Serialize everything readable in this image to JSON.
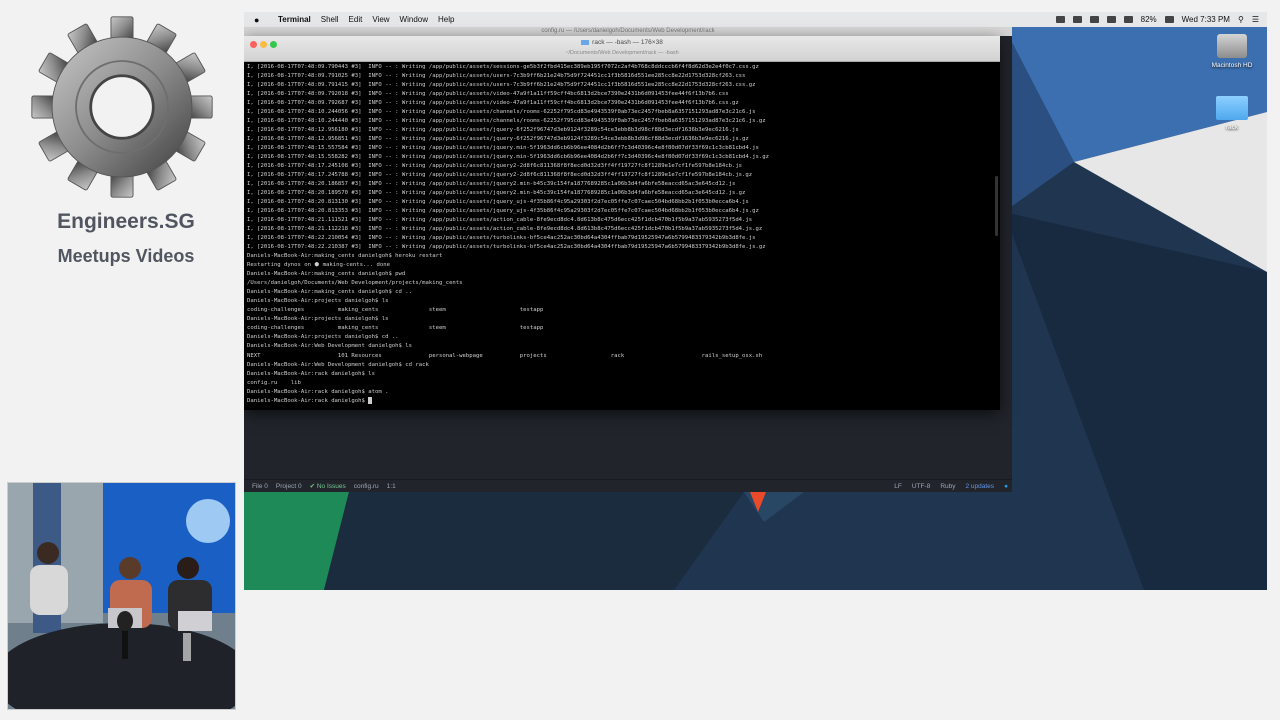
{
  "brand": {
    "title": "Engineers.SG",
    "subtitle": "Meetups Videos"
  },
  "menubar": {
    "app": "Terminal",
    "items": [
      "Shell",
      "Edit",
      "View",
      "Window",
      "Help"
    ],
    "battery": "82%",
    "clock": "Wed 7:33 PM"
  },
  "editor": {
    "title": "config.ru — /Users/danielgoh/Documents/Web Development/rack",
    "status": {
      "file": "File 0",
      "project": "Project 0",
      "issues": "No Issues",
      "filename": "config.ru",
      "cursor": "1:1",
      "line_ending": "LF",
      "encoding": "UTF-8",
      "grammar": "Ruby",
      "updates": "2 updates"
    }
  },
  "terminal": {
    "title": "rack — -bash — 176×38",
    "subtitle": "~/Documents/Web Development/rack — -bash",
    "lines": [
      "I, [2016-08-17T07:48:09.790443 #3]  INFO -- : Writing /app/public/assets/sessions-ge5b3f2fbd415ec389eb195f7072c2af4b768c8ddcccb6f4f8d62d3e2e4f0c7.css.gz",
      "I, [2016-08-17T07:48:09.791025 #3]  INFO -- : Writing /app/public/assets/users-7c3b9ff6b21e24b75d9f724451cc1f3b5816d551ee285cc8e22d1753d328cf263.css",
      "I, [2016-08-17T07:48:09.791415 #3]  INFO -- : Writing /app/public/assets/users-7c3b9ff6b21e24b75d9f724451cc1f3b5816d551ee285cc8e22d1753d328cf263.css.gz",
      "I, [2016-08-17T07:48:09.792018 #3]  INFO -- : Writing /app/public/assets/video-47a9f1a11ff59cff4bc6813d2bce7390e2431b6d091453fee44f6f13b7b6.css",
      "I, [2016-08-17T07:48:09.792687 #3]  INFO -- : Writing /app/public/assets/video-47a9f1a11ff59cff4bc6813d2bce7390e2431b6d091453fee44f6f13b7b6.css.gz",
      "I, [2016-08-17T07:48:10.244056 #3]  INFO -- : Writing /app/public/assets/channels/rooms-62252f795cd83e4943539f0ab73ec2457fbeb8a6357151293ad87e3c21c6.js",
      "I, [2016-08-17T07:48:10.244440 #3]  INFO -- : Writing /app/public/assets/channels/rooms-62252f795cd83e4943539f0ab73ec2457fbeb8a6357151293ad87e3c21c6.js.gz",
      "I, [2016-08-17T07:48:12.956180 #3]  INFO -- : Writing /app/public/assets/jquery-6f252f96747d3eb9124f3289c54ce3ebb8b3d98cf88d3ecdf1636b3e9ec6216.js",
      "I, [2016-08-17T07:48:12.956851 #3]  INFO -- : Writing /app/public/assets/jquery-6f252f96747d3eb9124f3289c54ce3ebb8b3d98cf88d3ecdf1636b3e9ec6216.js.gz",
      "I, [2016-08-17T07:48:15.557584 #3]  INFO -- : Writing /app/public/assets/jquery.min-5f1963dd6cb6b96ee4084d2b6ff7c3d40396c4e8f80d07df33f69c1c3cb81cbd4.js",
      "I, [2016-08-17T07:48:15.558282 #3]  INFO -- : Writing /app/public/assets/jquery.min-5f1963dd6cb6b96ee4084d2b6ff7c3d40396c4e8f80d07df33f69c1c3cb81cbd4.js.gz",
      "I, [2016-08-17T07:48:17.245108 #3]  INFO -- : Writing /app/public/assets/jquery2-2d8f6c811368f8f8ecd0d32d3ff4ff19727fc8f1289e1e7cf1fe597b8e184cb.js",
      "I, [2016-08-17T07:48:17.245788 #3]  INFO -- : Writing /app/public/assets/jquery2-2d8f6c811368f8f8ecd0d32d3ff4ff19727fc8f1289e1e7cf1fe597b8e184cb.js.gz",
      "I, [2016-08-17T07:48:20.186857 #3]  INFO -- : Writing /app/public/assets/jquery2.min-b45c39c154fa1877689285c1a06b3d4fa6bfe58eaccd65ac3e645cd12.js",
      "I, [2016-08-17T07:48:20.189570 #3]  INFO -- : Writing /app/public/assets/jquery2.min-b45c39c154fa1877689285c1a06b3d4fa6bfe58eaccd65ac3e645cd12.js.gz",
      "I, [2016-08-17T07:48:20.813130 #3]  INFO -- : Writing /app/public/assets/jquery_ujs-4f35b86f4c95a29303f2d7ec05ffe7c07caec504bd68bb2b1f053b0ecca6b4.js",
      "I, [2016-08-17T07:48:20.813353 #3]  INFO -- : Writing /app/public/assets/jquery_ujs-4f35b86f4c95a29303f2d7ec05ffe7c07caec504bd68bb2b1f053b0ecca6b4.js.gz",
      "I, [2016-08-17T07:48:21.111521 #3]  INFO -- : Writing /app/public/assets/action_cable-8fe9ecd8dc4.8d613b8c475d6ecc425f1dcb470b1f5b9a37ab5935273f5d4.js",
      "I, [2016-08-17T07:48:21.112218 #3]  INFO -- : Writing /app/public/assets/action_cable-8fe9ecd8dc4.8d613b8c475d6ecc425f1dcb470b1f5b9a37ab5935273f5d4.js.gz",
      "I, [2016-08-17T07:48:22.210054 #3]  INFO -- : Writing /app/public/assets/turbolinks-bf5ce4ac252ac30bd64a4304ffbab79d19525947a6b5799483379342b9b3d8fe.js",
      "I, [2016-08-17T07:48:22.210387 #3]  INFO -- : Writing /app/public/assets/turbolinks-bf5ce4ac252ac30bd64a4304ffbab79d19525947a6b5799483379342b9b3d8fe.js.gz",
      "Daniels-MacBook-Air:making_cents danielgoh$ heroku restart",
      "Restarting dynos on ⬢ making-cents... done",
      "Daniels-MacBook-Air:making_cents danielgoh$ pwd",
      "/Users/danielgoh/Documents/Web Development/projects/making_cents",
      "Daniels-MacBook-Air:making_cents danielgoh$ cd ..",
      "Daniels-MacBook-Air:projects danielgoh$ ls",
      "coding-challenges          making_cents               steem                      testapp",
      "Daniels-MacBook-Air:projects danielgoh$ ls",
      "coding-challenges          making_cents               steem                      testapp",
      "Daniels-MacBook-Air:projects danielgoh$ cd ..",
      "Daniels-MacBook-Air:Web Development danielgoh$ ls",
      "NEXT                       101 Resources              personal-webpage           projects                   rack                       rails_setup_osx.sh",
      "Daniels-MacBook-Air:Web Development danielgoh$ cd rack",
      "Daniels-MacBook-Air:rack danielgoh$ ls",
      "config.ru    lib",
      "Daniels-MacBook-Air:rack danielgoh$ atom .",
      "Daniels-MacBook-Air:rack danielgoh$ "
    ]
  },
  "desktop": {
    "items": [
      {
        "label": "Macintosh HD"
      },
      {
        "label": "rack"
      }
    ]
  },
  "colors": {
    "brand_text": "#505560",
    "terminal_bg": "#000000",
    "editor_bg": "#21252b",
    "status_ok": "#73c990"
  }
}
